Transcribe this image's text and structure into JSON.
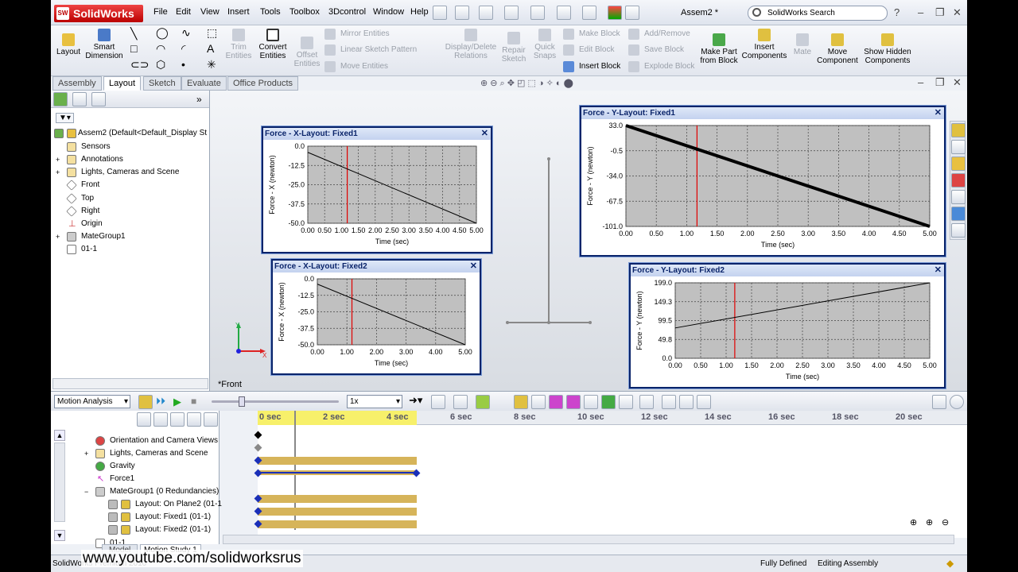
{
  "app": {
    "logo": "SolidWorks",
    "document_title": "Assem2 *"
  },
  "menu": [
    "File",
    "Edit",
    "View",
    "Insert",
    "Tools",
    "Toolbox",
    "3Dcontrol",
    "Window",
    "Help"
  ],
  "search": {
    "placeholder": "SolidWorks Search"
  },
  "cmd": {
    "layout": "Layout",
    "smart_dimension": "Smart Dimension",
    "trim": "Trim Entities",
    "convert": "Convert Entities",
    "offset": "Offset Entities",
    "mirror": "Mirror Entities",
    "linear_pattern": "Linear Sketch Pattern",
    "move_entities": "Move Entities",
    "display_delete": "Display/Delete Relations",
    "repair": "Repair Sketch",
    "quick_snaps": "Quick Snaps",
    "make_block": "Make Block",
    "edit_block": "Edit Block",
    "insert_block": "Insert Block",
    "add_remove": "Add/Remove",
    "save_block": "Save Block",
    "explode_block": "Explode Block",
    "make_part": "Make Part from Block",
    "insert_components": "Insert Components",
    "mate": "Mate",
    "move_component": "Move Component",
    "show_hidden": "Show Hidden Components"
  },
  "tabs": [
    "Assembly",
    "Layout",
    "Sketch",
    "Evaluate",
    "Office Products"
  ],
  "tree": [
    {
      "label": "Assem2  (Default<Default_Display St"
    },
    {
      "label": "Sensors"
    },
    {
      "label": "Annotations"
    },
    {
      "label": "Lights, Cameras and Scene"
    },
    {
      "label": "Front"
    },
    {
      "label": "Top"
    },
    {
      "label": "Right"
    },
    {
      "label": "Origin"
    },
    {
      "label": "MateGroup1"
    },
    {
      "label": "01-1"
    }
  ],
  "view_label": "*Front",
  "colors": {
    "title_blue": "#0a246a",
    "plot_bg": "#c0c0c0",
    "marker_red": "#e00000",
    "timeline_bar": "#d6b45a",
    "key_blue": "#1a2fb8"
  },
  "chart_data": [
    {
      "type": "line",
      "title": "Force - X-Layout: Fixed1",
      "xlabel": "Time (sec)",
      "ylabel": "Force - X (newton)",
      "x_ticks": [
        "0.00",
        "0.50",
        "1.00",
        "1.50",
        "2.00",
        "2.50",
        "3.00",
        "3.50",
        "4.00",
        "4.50",
        "5.00"
      ],
      "y_ticks": [
        "0.0",
        "-12.5",
        "-25.0",
        "-37.5",
        "-50.0"
      ],
      "xlim": [
        0,
        5
      ],
      "ylim": [
        -50,
        0
      ],
      "series": [
        {
          "x": [
            0,
            5
          ],
          "y": [
            -4,
            -50
          ]
        }
      ],
      "marker_x": 1.17
    },
    {
      "type": "line",
      "title": "Force - X-Layout: Fixed2",
      "xlabel": "Time (sec)",
      "ylabel": "Force - X (newton)",
      "x_ticks": [
        "0.00",
        "1.00",
        "2.00",
        "3.00",
        "4.00",
        "5.00"
      ],
      "y_ticks": [
        "0.0",
        "-12.5",
        "-25.0",
        "-37.5",
        "-50.0"
      ],
      "xlim": [
        0,
        5
      ],
      "ylim": [
        -50,
        0
      ],
      "series": [
        {
          "x": [
            0,
            5
          ],
          "y": [
            -4,
            -50
          ]
        }
      ],
      "marker_x": 1.17
    },
    {
      "type": "line",
      "title": "Force - Y-Layout: Fixed1",
      "xlabel": "Time (sec)",
      "ylabel": "Force - Y (newton)",
      "x_ticks": [
        "0.00",
        "0.50",
        "1.00",
        "1.50",
        "2.00",
        "2.50",
        "3.00",
        "3.50",
        "4.00",
        "4.50",
        "5.00"
      ],
      "y_ticks": [
        "33.0",
        "-0.5",
        "-34.0",
        "-67.5",
        "-101.0"
      ],
      "xlim": [
        0,
        5
      ],
      "ylim": [
        -101,
        33
      ],
      "series": [
        {
          "x": [
            0,
            5
          ],
          "y": [
            33,
            -101
          ]
        }
      ],
      "marker_x": 1.17
    },
    {
      "type": "line",
      "title": "Force - Y-Layout: Fixed2",
      "xlabel": "Time (sec)",
      "ylabel": "Force - Y (newton)",
      "x_ticks": [
        "0.00",
        "0.50",
        "1.00",
        "1.50",
        "2.00",
        "2.50",
        "3.00",
        "3.50",
        "4.00",
        "4.50",
        "5.00"
      ],
      "y_ticks": [
        "199.0",
        "149.3",
        "99.5",
        "49.8",
        "0.0"
      ],
      "xlim": [
        0,
        5
      ],
      "ylim": [
        0,
        199
      ],
      "series": [
        {
          "x": [
            0,
            5
          ],
          "y": [
            80,
            199
          ]
        }
      ],
      "marker_x": 1.17
    }
  ],
  "motion": {
    "study_type": "Motion Analysis",
    "zoom_value": "1x",
    "time_labels": [
      "0 sec",
      "2 sec",
      "4 sec",
      "6 sec",
      "8 sec",
      "10 sec",
      "12 sec",
      "14 sec",
      "16 sec",
      "18 sec",
      "20 sec"
    ],
    "items": [
      {
        "label": "Orientation and Camera Views"
      },
      {
        "label": "Lights, Cameras and Scene"
      },
      {
        "label": "Gravity"
      },
      {
        "label": "Force1"
      },
      {
        "label": "MateGroup1 (0 Redundancies)"
      },
      {
        "label": "Layout: On Plane2 (01-1"
      },
      {
        "label": "Layout: Fixed1 (01-1)"
      },
      {
        "label": "Layout: Fixed2 (01-1)"
      },
      {
        "label": "01-1"
      }
    ],
    "tabs": [
      "Model",
      "Motion Study 1"
    ]
  },
  "status": {
    "left": "SolidWorks Premium 2010",
    "fully_defined": "Fully Defined",
    "editing": "Editing Assembly"
  },
  "watermark": "www.youtube.com/solidworksrus"
}
